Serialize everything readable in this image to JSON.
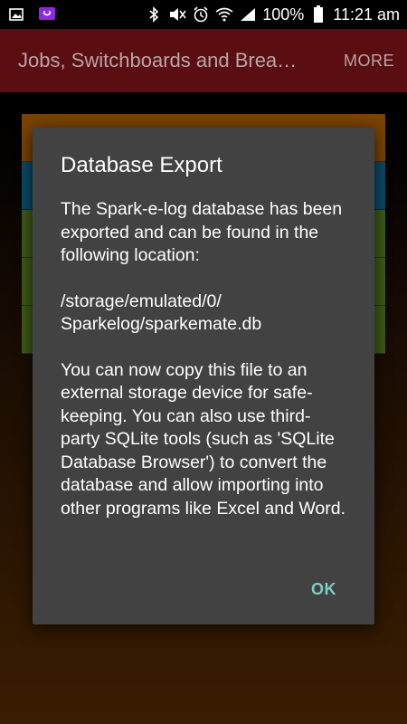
{
  "status_bar": {
    "battery_percent": "100%",
    "time": "11:21 am",
    "icons": [
      "gallery-icon",
      "chat-icon",
      "bluetooth-icon",
      "mute-icon",
      "alarm-icon",
      "wifi-icon",
      "signal-icon",
      "battery-icon"
    ]
  },
  "action_bar": {
    "title": "Jobs, Switchboards and Brea…",
    "more_label": "MORE"
  },
  "dialog": {
    "title": "Database Export",
    "paragraph_1": "The Spark-e-log database has been exported and can be found in the following location:",
    "path": "/storage/emulated/0/ Sparkelog/sparkemate.db",
    "paragraph_2": "You can now copy this file to an external storage device for safe-keeping. You can also use third-party SQLite tools (such as 'SQLite Database Browser') to convert the database and allow importing into other programs like Excel and Word.",
    "ok_label": "OK"
  },
  "colors": {
    "action_bar": "#5b0e12",
    "dialog_bg": "#424242",
    "ok_accent": "#7fcbc4"
  }
}
